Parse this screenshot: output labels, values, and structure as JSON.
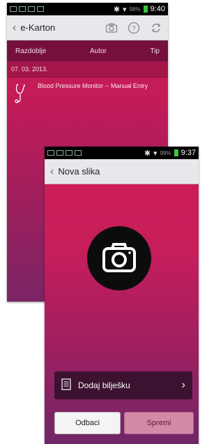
{
  "back_screen": {
    "status": {
      "battery_pct": "98%",
      "time": "9:40"
    },
    "title": "e-Karton",
    "tabs": [
      "Razdoblje",
      "Autor",
      "Tip"
    ],
    "date_header": "07. 03. 2013.",
    "entry": {
      "label": "Blood Pressure Monitor -- Manual Entry"
    }
  },
  "front_screen": {
    "status": {
      "battery_pct": "99%",
      "time": "9:37"
    },
    "title": "Nova slika",
    "note_button": "Dodaj bilješku",
    "discard_button": "Odbaci",
    "save_button": "Spremi"
  },
  "colors": {
    "tab_bar": "#75103b",
    "date_header": "#a4154a",
    "note_button": "#3c1230",
    "save_button": "#d28aa8"
  },
  "icons": [
    "camera-icon",
    "help-icon",
    "refresh-icon",
    "stethoscope-icon",
    "note-icon",
    "chevron-right-icon",
    "back-chevron-icon"
  ]
}
